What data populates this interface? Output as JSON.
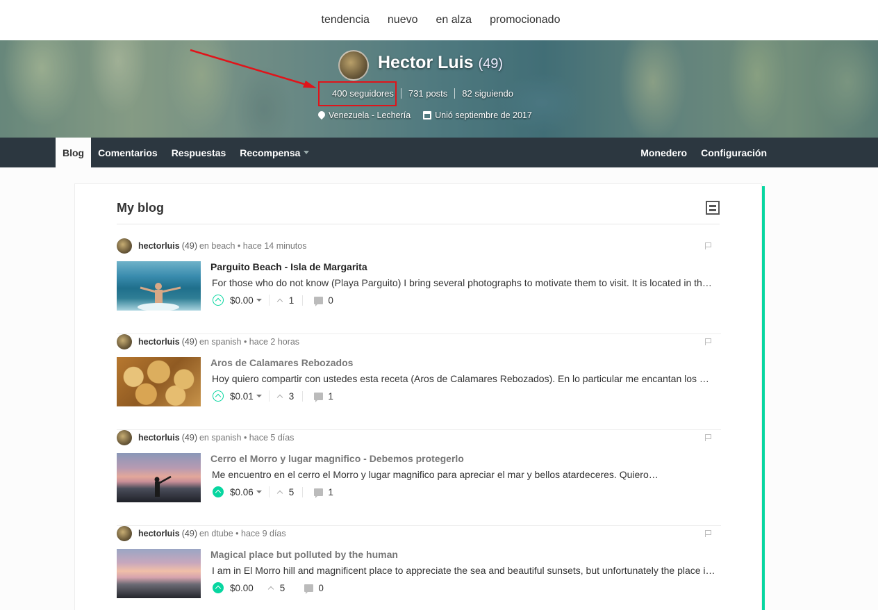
{
  "top_nav": [
    "tendencia",
    "nuevo",
    "en alza",
    "promocionado"
  ],
  "profile": {
    "name": "Hector Luis",
    "reputation": "(49)",
    "followers": "400 seguidores",
    "posts": "731 posts",
    "following": "82 siguiendo",
    "location": "Venezuela - Lechería",
    "joined": "Unió septiembre de 2017"
  },
  "tabs": {
    "blog": "Blog",
    "comments": "Comentarios",
    "replies": "Respuestas",
    "rewards": "Recompensa",
    "wallet": "Monedero",
    "settings": "Configuración"
  },
  "blog": {
    "title": "My blog",
    "posts": [
      {
        "author": "hectorluis",
        "rep": "(49)",
        "category": "en beach",
        "time": "• hace 14 minutos",
        "title": "Parguito Beach - Isla de Margarita",
        "body": "For those who do not know (Playa Parguito) I bring several photographs to motivate them to visit. It is located in the northeast of Margarita Island",
        "payout": "$0.00",
        "votes": "1",
        "comments": "0"
      },
      {
        "author": "hectorluis",
        "rep": "(49)",
        "category": "en spanish",
        "time": "• hace 2 horas",
        "title": "Aros de Calamares Rebozados",
        "body": "Hoy quiero compartir con ustedes esta receta (Aros de Calamares Rebozados). En lo particular me encantan los mariscos",
        "payout": "$0.01",
        "votes": "3",
        "comments": "1"
      },
      {
        "author": "hectorluis",
        "rep": "(49)",
        "category": "en spanish",
        "time": "• hace 5 días",
        "title": "Cerro el Morro y lugar magnifico - Debemos protegerlo",
        "body": "Me encuentro en el cerro el Morro y lugar magnifico para apreciar el mar y bellos atardeceres. Quiero…",
        "payout": "$0.06",
        "votes": "5",
        "comments": "1"
      },
      {
        "author": "hectorluis",
        "rep": "(49)",
        "category": "en dtube",
        "time": "• hace 9 días",
        "title": "Magical place but polluted by the human",
        "body": "I am in El Morro hill and magnificent place to appreciate the sea and beautiful sunsets, but unfortunately the place is polluted",
        "payout": "$0.00",
        "votes": "5",
        "comments": "0"
      }
    ]
  },
  "colors": {
    "accent": "#07d6a0",
    "nav_bg": "#2c3740",
    "highlight": "#e0141a"
  }
}
